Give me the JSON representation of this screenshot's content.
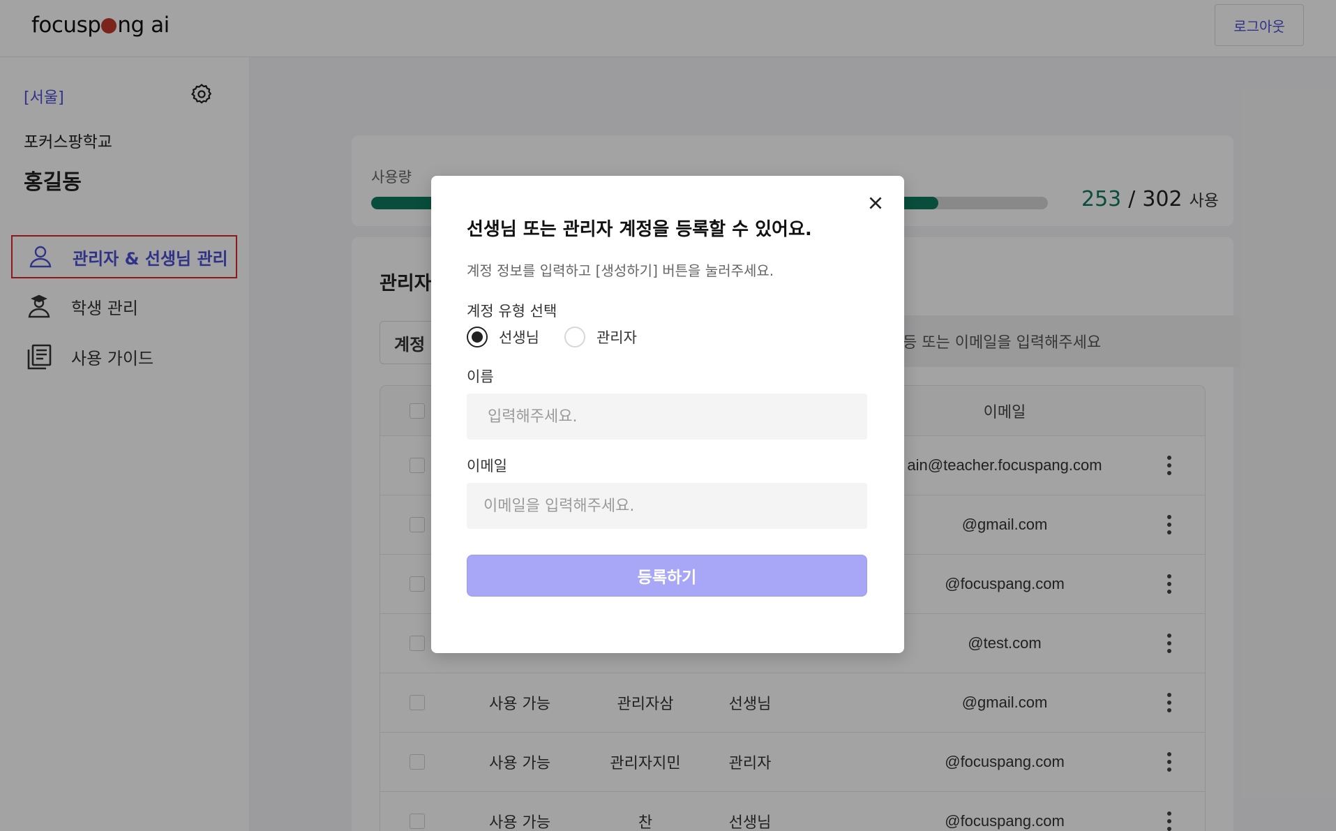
{
  "header": {
    "logo_text_before": "focusp",
    "logo_text_after": "ng ai",
    "logout_label": "로그아웃"
  },
  "sidebar": {
    "region": "[서울]",
    "school": "포커스팡학교",
    "user_name": "홍길동",
    "items": [
      {
        "label": "관리자 & 선생님 관리",
        "icon": "person-icon",
        "active": true
      },
      {
        "label": "학생 관리",
        "icon": "student-icon",
        "active": false
      },
      {
        "label": "사용 가이드",
        "icon": "book-icon",
        "active": false
      }
    ]
  },
  "usage": {
    "label": "사용량",
    "used": "253",
    "slash": "/",
    "total": "302",
    "unit": "사용",
    "fraction": 0.838
  },
  "accounts": {
    "title": "관리자",
    "filter_label": "계정",
    "search_placeholder_visible": "등 또는 이메일을 입력해주세요",
    "columns": {
      "email": "이메일"
    },
    "rows": [
      {
        "status": "",
        "name": "",
        "type": "",
        "email": "ain@teacher.focuspang.com"
      },
      {
        "status": "",
        "name": "",
        "type": "",
        "email": "@gmail.com"
      },
      {
        "status": "",
        "name": "",
        "type": "",
        "email": "@focuspang.com"
      },
      {
        "status": "",
        "name": "",
        "type": "",
        "email": "@test.com"
      },
      {
        "status": "사용 가능",
        "name": "관리자삼",
        "type": "선생님",
        "email": "@gmail.com"
      },
      {
        "status": "사용 가능",
        "name": "관리자지민",
        "type": "관리자",
        "email": "@focuspang.com"
      },
      {
        "status": "사용 가능",
        "name": "찬",
        "type": "선생님",
        "email": "@focuspang.com"
      }
    ]
  },
  "modal": {
    "title": "선생님 또는 관리자 계정을 등록할 수 있어요.",
    "description": "계정 정보를 입력하고 [생성하기] 버튼을 눌러주세요.",
    "type_label": "계정 유형 선택",
    "type_options": [
      {
        "label": "선생님",
        "checked": true
      },
      {
        "label": "관리자",
        "checked": false
      }
    ],
    "name_label": "이름",
    "name_placeholder": "입력해주세요.",
    "email_label": "이메일",
    "email_placeholder": "이메일을 입력해주세요.",
    "submit_label": "등록하기"
  },
  "colors": {
    "accent": "#4b4fd3",
    "usage_fill": "#0f7a5f",
    "submit_disabled": "#a8a7f7",
    "active_outline": "#e02424"
  }
}
